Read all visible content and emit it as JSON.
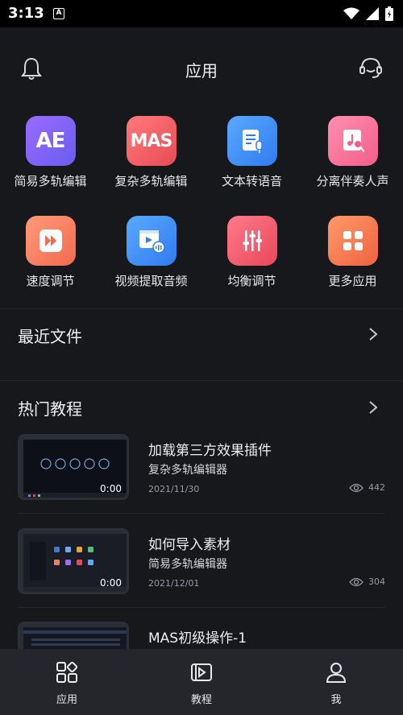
{
  "status_bar": {
    "time": "3:13",
    "notification_badge": "A"
  },
  "header": {
    "title": "应用"
  },
  "apps": [
    {
      "label": "简易多轨编辑",
      "icon": "AE",
      "icon_name": "ae-icon",
      "color_from": "#9b6bff",
      "color_to": "#6a5cf0"
    },
    {
      "label": "复杂多轨编辑",
      "icon": "MAS",
      "icon_name": "mas-icon",
      "color_from": "#ff7a7a",
      "color_to": "#e84b55"
    },
    {
      "label": "文本转语音",
      "icon": "",
      "icon_name": "text-to-speech-icon",
      "color_from": "#5aa9ff",
      "color_to": "#2f7cf0"
    },
    {
      "label": "分离伴奏人声",
      "icon": "",
      "icon_name": "music-mic-icon",
      "color_from": "#ff8fb1",
      "color_to": "#f25e8a"
    },
    {
      "label": "速度调节",
      "icon": "",
      "icon_name": "fast-forward-icon",
      "color_from": "#ff9a7a",
      "color_to": "#f26a4f"
    },
    {
      "label": "视频提取音频",
      "icon": "",
      "icon_name": "video-audio-icon",
      "color_from": "#5aa9ff",
      "color_to": "#2f7cf0"
    },
    {
      "label": "均衡调节",
      "icon": "",
      "icon_name": "equalizer-icon",
      "color_from": "#ff7a8a",
      "color_to": "#e8485a"
    },
    {
      "label": "更多应用",
      "icon": "",
      "icon_name": "more-apps-icon",
      "color_from": "#ff9a6a",
      "color_to": "#f0623f"
    }
  ],
  "recent": {
    "title": "最近文件"
  },
  "tutorials": {
    "title": "热门教程",
    "items": [
      {
        "title": "加载第三方效果插件",
        "category": "复杂多轨编辑器",
        "date": "2021/11/30",
        "views": "442",
        "duration": "0:00"
      },
      {
        "title": "如何导入素材",
        "category": "简易多轨编辑器",
        "date": "2021/12/01",
        "views": "304",
        "duration": "0:00"
      },
      {
        "title": "MAS初级操作-1",
        "category": "",
        "date": "",
        "views": "",
        "duration": ""
      }
    ]
  },
  "tabbar": {
    "tabs": [
      {
        "label": "应用"
      },
      {
        "label": "教程"
      },
      {
        "label": "我"
      }
    ]
  }
}
